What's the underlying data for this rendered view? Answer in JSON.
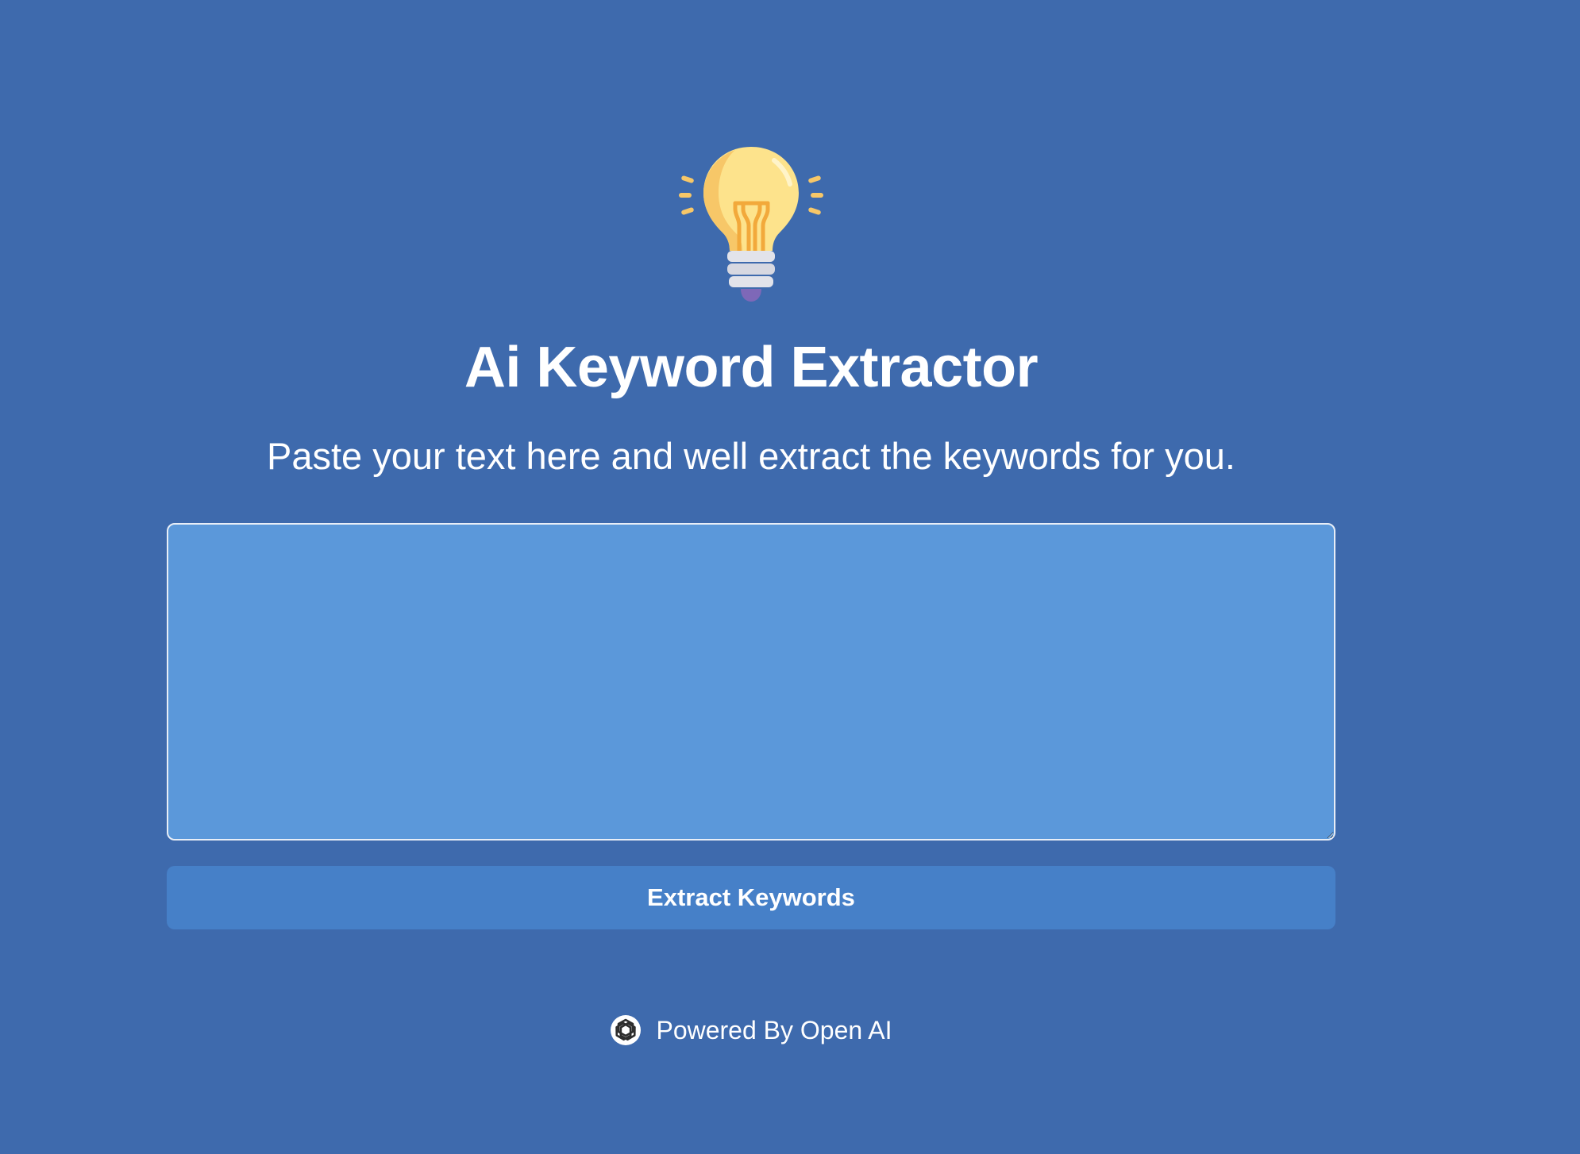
{
  "header": {
    "logo_icon": "lightbulb-icon",
    "title": "Ai Keyword Extractor",
    "subtitle": "Paste your text here and well extract the keywords for you."
  },
  "input": {
    "value": "",
    "placeholder": ""
  },
  "actions": {
    "extract_label": "Extract Keywords"
  },
  "footer": {
    "icon": "openai-logo-icon",
    "text": "Powered By Open AI"
  },
  "colors": {
    "background": "#3e6aad",
    "textarea_bg": "#5b98da",
    "button_bg": "#4680c8",
    "text": "#ffffff",
    "bulb_glass": "#fde38c",
    "bulb_shade": "#f7c768",
    "filament": "#f2a93b",
    "base_silver": "#e2e3ea",
    "base_tip": "#7e68b8"
  }
}
